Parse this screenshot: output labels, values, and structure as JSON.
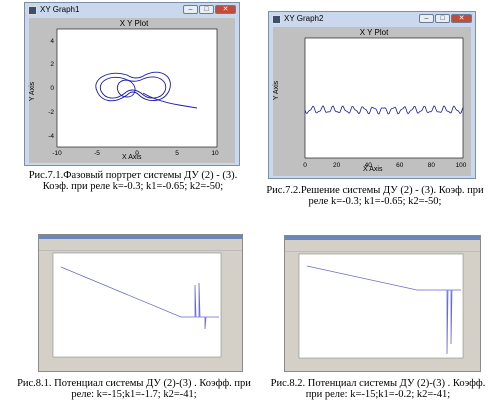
{
  "fig71": {
    "window_title": "XY Graph1",
    "plot_title": "X Y Plot",
    "xlabel": "X Axis",
    "ylabel": "Y Axis",
    "xticks": [
      "-10",
      "-5",
      "0",
      "5",
      "10"
    ],
    "yticks": [
      "-4",
      "-2",
      "0",
      "2",
      "4"
    ],
    "caption": "Рис.7.1.Фазовый портрет системы ДУ (2) - (3). Коэф. при реле k=-0.3; k1=-0.65; k2=-50;"
  },
  "fig72": {
    "window_title": "XY Graph2",
    "plot_title": "X Y Plot",
    "xlabel": "X Axis",
    "ylabel": "Y Axis",
    "xticks": [
      "0",
      "20",
      "40",
      "60",
      "80",
      "100"
    ],
    "caption": "Рис.7.2.Решение системы ДУ (2) - (3). Коэф. при реле k=-0.3; k1=-0.65; k2=-50;"
  },
  "fig81": {
    "caption": "Рис.8.1. Потенциал системы ДУ (2)-(3) . Коэфф. при реле: k=-15;k1=-1.7; k2=-41;"
  },
  "fig82": {
    "caption": "Рис.8.2. Потенциал системы ДУ (2)-(3) . Коэфф. при реле: k=-15;k1=-0.2; k2=-41;"
  },
  "colors": {
    "window": "#c9d8ec",
    "figure_bg": "#c0c0c0",
    "plot_line": "#1a1aa8",
    "mat_line": "#6a6ad0"
  },
  "icons": [
    "minimize-icon",
    "maximize-icon",
    "close-icon"
  ],
  "window_buttons": {
    "minimize": "–",
    "maximize": "□",
    "close": "✕"
  }
}
